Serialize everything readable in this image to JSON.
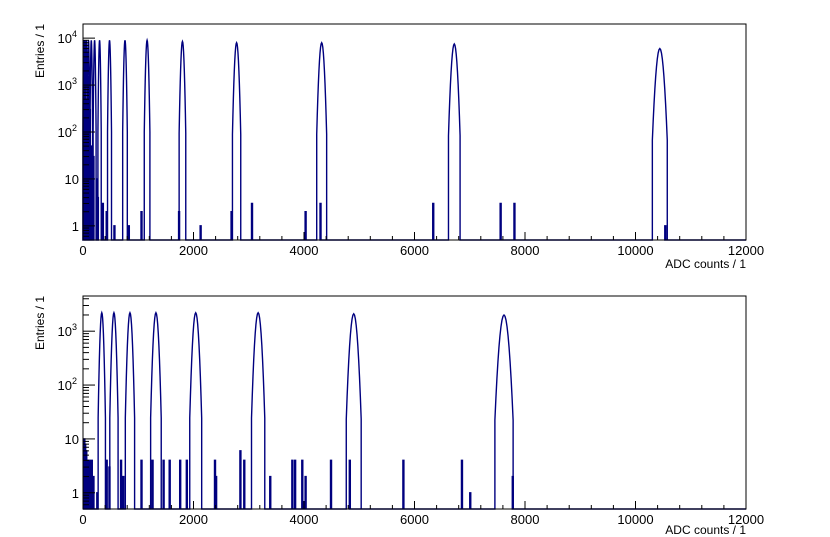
{
  "chart_data": [
    {
      "type": "histogram",
      "log_y": true,
      "xlabel": "ADC counts / 1",
      "ylabel": "Entries / 1",
      "xlim": [
        0,
        12000
      ],
      "ylim": [
        0.5,
        20000
      ],
      "x_ticks": [
        0,
        2000,
        4000,
        6000,
        8000,
        10000,
        12000
      ],
      "x_tick_labels": [
        "0",
        "2000",
        "4000",
        "6000",
        "8000",
        "10000",
        "12000"
      ],
      "y_ticks": [
        1,
        10,
        100,
        1000,
        10000
      ],
      "y_tick_labels": [
        {
          "base": "1",
          "exp": ""
        },
        {
          "base": "10",
          "exp": ""
        },
        {
          "base": "10",
          "exp": "2"
        },
        {
          "base": "10",
          "exp": "3"
        },
        {
          "base": "10",
          "exp": "4"
        }
      ],
      "color": "#00007f",
      "peaks": [
        {
          "center": 10,
          "height": 9000,
          "sigma": 4
        },
        {
          "center": 30,
          "height": 9000,
          "sigma": 5
        },
        {
          "center": 60,
          "height": 9000,
          "sigma": 6
        },
        {
          "center": 100,
          "height": 9000,
          "sigma": 7
        },
        {
          "center": 150,
          "height": 9000,
          "sigma": 8
        },
        {
          "center": 210,
          "height": 9000,
          "sigma": 9
        },
        {
          "center": 300,
          "height": 9000,
          "sigma": 10
        },
        {
          "center": 480,
          "height": 9000,
          "sigma": 12
        },
        {
          "center": 760,
          "height": 9000,
          "sigma": 14
        },
        {
          "center": 1160,
          "height": 9000,
          "sigma": 17
        },
        {
          "center": 1800,
          "height": 8500,
          "sigma": 20
        },
        {
          "center": 2780,
          "height": 8000,
          "sigma": 25
        },
        {
          "center": 4320,
          "height": 8000,
          "sigma": 30
        },
        {
          "center": 6720,
          "height": 7500,
          "sigma": 35
        },
        {
          "center": 10440,
          "height": 6000,
          "sigma": 45
        }
      ],
      "spikes": [
        {
          "x": 25,
          "y": 2000
        },
        {
          "x": 45,
          "y": 500
        },
        {
          "x": 75,
          "y": 1500
        },
        {
          "x": 115,
          "y": 300
        },
        {
          "x": 135,
          "y": 50
        },
        {
          "x": 180,
          "y": 30
        },
        {
          "x": 240,
          "y": 10
        },
        {
          "x": 260,
          "y": 4
        },
        {
          "x": 350,
          "y": 3
        },
        {
          "x": 420,
          "y": 2
        },
        {
          "x": 560,
          "y": 1
        },
        {
          "x": 820,
          "y": 1
        },
        {
          "x": 1050,
          "y": 2
        },
        {
          "x": 1730,
          "y": 2
        },
        {
          "x": 2120,
          "y": 1
        },
        {
          "x": 2680,
          "y": 2
        },
        {
          "x": 3050,
          "y": 3
        },
        {
          "x": 4020,
          "y": 2
        },
        {
          "x": 4290,
          "y": 3
        },
        {
          "x": 6330,
          "y": 3
        },
        {
          "x": 7550,
          "y": 3
        },
        {
          "x": 7800,
          "y": 3
        },
        {
          "x": 10530,
          "y": 1
        }
      ]
    },
    {
      "type": "histogram",
      "log_y": true,
      "xlabel": "ADC counts / 1",
      "ylabel": "Entries / 1",
      "xlim": [
        0,
        12000
      ],
      "ylim": [
        0.5,
        4500
      ],
      "x_ticks": [
        0,
        2000,
        4000,
        6000,
        8000,
        10000,
        12000
      ],
      "x_tick_labels": [
        "0",
        "2000",
        "4000",
        "6000",
        "8000",
        "10000",
        "12000"
      ],
      "y_ticks": [
        1,
        10,
        100,
        1000
      ],
      "y_tick_labels": [
        {
          "base": "1",
          "exp": ""
        },
        {
          "base": "10",
          "exp": ""
        },
        {
          "base": "10",
          "exp": "2"
        },
        {
          "base": "10",
          "exp": "3"
        }
      ],
      "color": "#00007f",
      "peaks": [
        {
          "center": 340,
          "height": 2200,
          "sigma": 22
        },
        {
          "center": 560,
          "height": 2200,
          "sigma": 25
        },
        {
          "center": 850,
          "height": 2200,
          "sigma": 28
        },
        {
          "center": 1320,
          "height": 2200,
          "sigma": 32
        },
        {
          "center": 2040,
          "height": 2200,
          "sigma": 36
        },
        {
          "center": 3170,
          "height": 2200,
          "sigma": 40
        },
        {
          "center": 4900,
          "height": 2100,
          "sigma": 45
        },
        {
          "center": 7620,
          "height": 2000,
          "sigma": 55
        }
      ],
      "spikes": [
        {
          "x": 15,
          "y": 10
        },
        {
          "x": 30,
          "y": 8
        },
        {
          "x": 50,
          "y": 6
        },
        {
          "x": 70,
          "y": 4
        },
        {
          "x": 90,
          "y": 3
        },
        {
          "x": 110,
          "y": 4
        },
        {
          "x": 130,
          "y": 2
        },
        {
          "x": 150,
          "y": 4
        },
        {
          "x": 180,
          "y": 2
        },
        {
          "x": 250,
          "y": 1
        },
        {
          "x": 420,
          "y": 4
        },
        {
          "x": 470,
          "y": 3
        },
        {
          "x": 680,
          "y": 4
        },
        {
          "x": 720,
          "y": 2
        },
        {
          "x": 1050,
          "y": 4
        },
        {
          "x": 1250,
          "y": 4
        },
        {
          "x": 1450,
          "y": 4
        },
        {
          "x": 1560,
          "y": 4
        },
        {
          "x": 1750,
          "y": 4
        },
        {
          "x": 1870,
          "y": 4
        },
        {
          "x": 2380,
          "y": 4
        },
        {
          "x": 2400,
          "y": 2
        },
        {
          "x": 2840,
          "y": 6
        },
        {
          "x": 2910,
          "y": 4
        },
        {
          "x": 3380,
          "y": 2
        },
        {
          "x": 3780,
          "y": 4
        },
        {
          "x": 3830,
          "y": 4
        },
        {
          "x": 3960,
          "y": 4
        },
        {
          "x": 4020,
          "y": 2
        },
        {
          "x": 4480,
          "y": 4
        },
        {
          "x": 4820,
          "y": 4
        },
        {
          "x": 5790,
          "y": 4
        },
        {
          "x": 6850,
          "y": 4
        },
        {
          "x": 7000,
          "y": 1
        },
        {
          "x": 7770,
          "y": 2
        }
      ]
    }
  ]
}
